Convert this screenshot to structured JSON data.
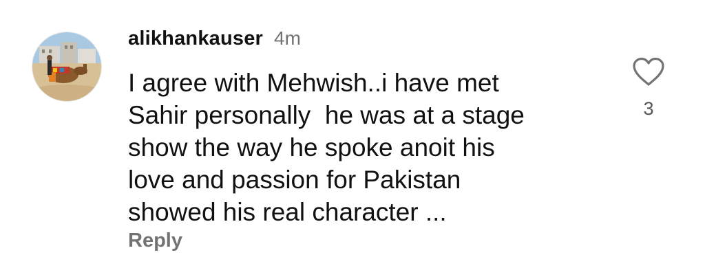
{
  "comment": {
    "username": "alikhankauser",
    "timestamp": "4m",
    "text_lines": [
      "I agree with Mehwish..i have met",
      "Sahir personally  he was at a stage",
      "show the way he spoke anoit his",
      "love and passion for Pakistan",
      "showed his real character ..."
    ],
    "reply_label": "Reply",
    "like_count": "3",
    "avatar_icon": "profile-photo-camel-beach",
    "like_icon": "heart-outline-icon"
  },
  "colors": {
    "text": "#111111",
    "secondary_text": "#737373",
    "background": "#ffffff"
  }
}
